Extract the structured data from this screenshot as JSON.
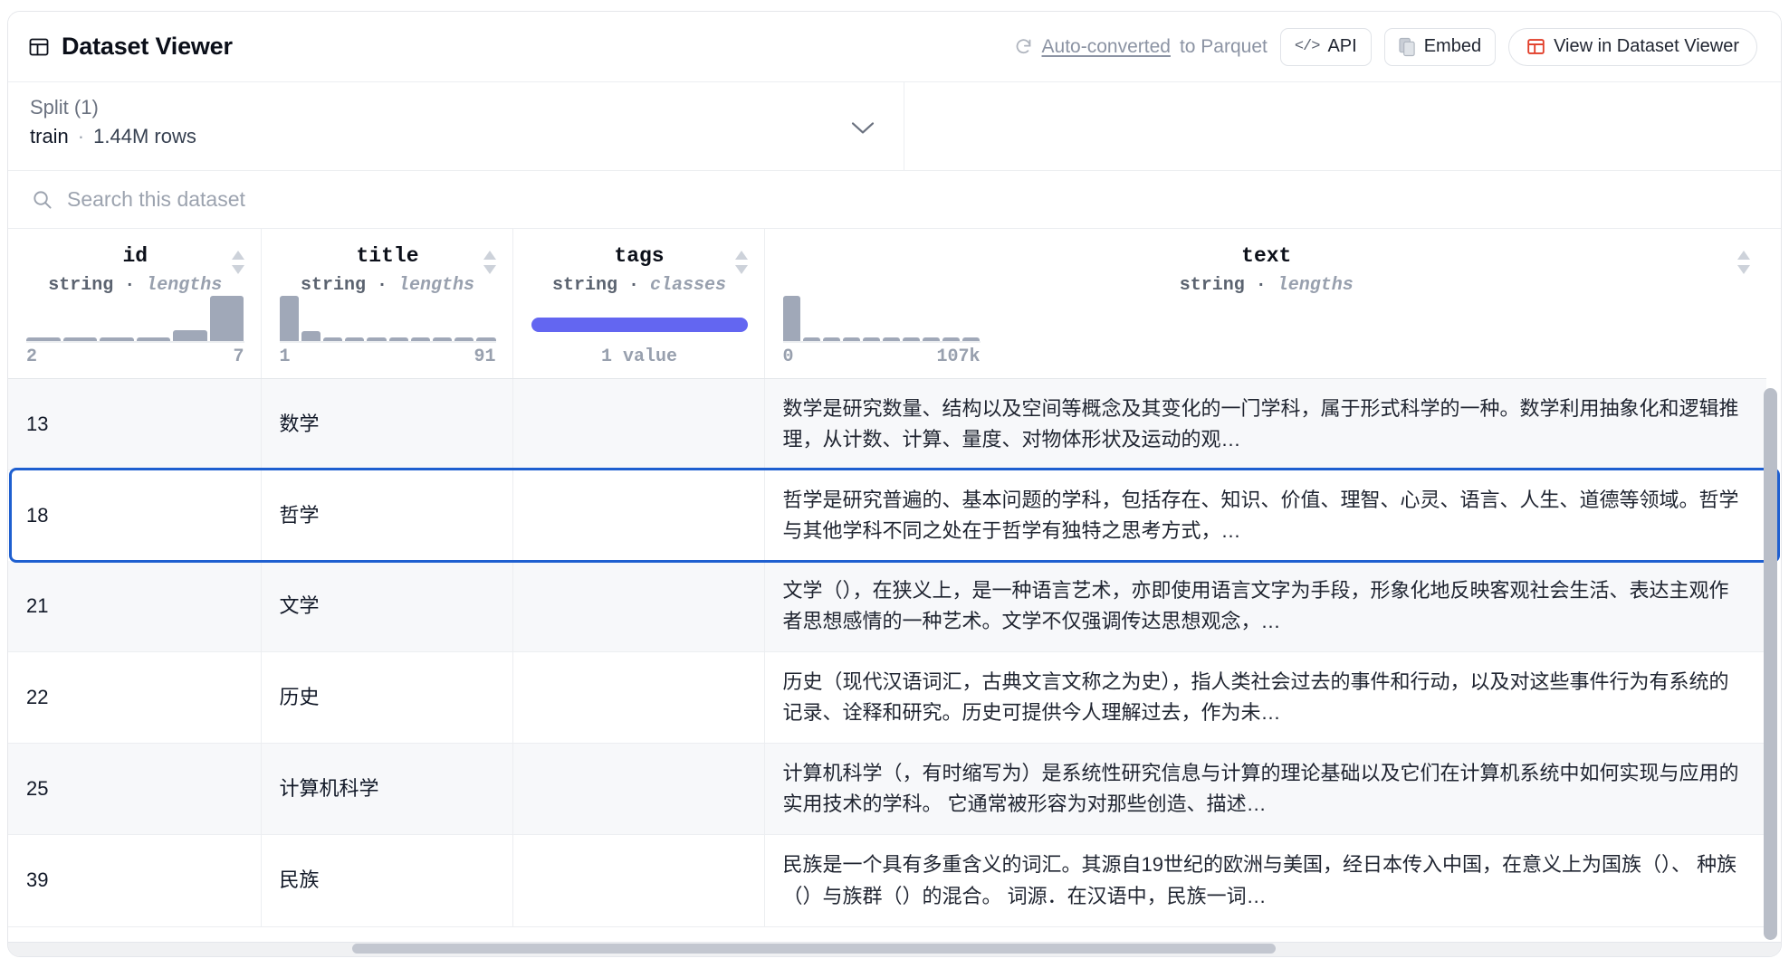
{
  "header": {
    "title": "Dataset Viewer",
    "title_icon": "grid-table-icon",
    "auto_converted": {
      "icon": "refresh-icon",
      "link_text": "Auto-converted",
      "suffix_text": " to Parquet"
    },
    "buttons": [
      {
        "id": "api",
        "label": "API",
        "icon": "code-brackets-icon"
      },
      {
        "id": "embed",
        "label": "Embed",
        "icon": "copy-icon"
      },
      {
        "id": "view-in-dataset-viewer",
        "label": "View in Dataset Viewer",
        "icon": "grid-table-icon-red"
      }
    ]
  },
  "split": {
    "label": "Split (1)",
    "name": "train",
    "separator": "·",
    "rows": "1.44M rows",
    "chevron_icon": "chevron-down-icon"
  },
  "search": {
    "placeholder": "Search this dataset",
    "value": "",
    "icon": "search-icon"
  },
  "columns": [
    {
      "name": "id",
      "type": "string",
      "stat": "lengths",
      "sortable": true,
      "hist": {
        "kind": "lengths",
        "min_label": "2",
        "max_label": "7",
        "bars": [
          4,
          4,
          4,
          4,
          12,
          50
        ]
      }
    },
    {
      "name": "title",
      "type": "string",
      "stat": "lengths",
      "sortable": true,
      "hist": {
        "kind": "lengths",
        "min_label": "1",
        "max_label": "91",
        "bars": [
          50,
          11,
          4,
          4,
          4,
          4,
          4,
          4,
          4,
          4
        ]
      }
    },
    {
      "name": "tags",
      "type": "string",
      "stat": "classes",
      "sortable": true,
      "hist": {
        "kind": "classes",
        "value_label": "1 value",
        "fill_ratio": 100,
        "color": "#6366f1"
      }
    },
    {
      "name": "text",
      "type": "string",
      "stat": "lengths",
      "sortable": true,
      "hist": {
        "kind": "lengths",
        "min_label": "0",
        "max_label": "107k",
        "bars": [
          50,
          4,
          4,
          4,
          4,
          4,
          4,
          4,
          4,
          4
        ]
      }
    }
  ],
  "rows": [
    {
      "id": "13",
      "title": "数学",
      "tags": "",
      "text": "数学是研究数量、结构以及空间等概念及其变化的一门学科，属于形式科学的一种。数学利用抽象化和逻辑推理，从计数、计算、量度、对物体形状及运动的观…",
      "selected": false
    },
    {
      "id": "18",
      "title": "哲学",
      "tags": "",
      "text": "哲学是研究普遍的、基本问题的学科，包括存在、知识、价值、理智、心灵、语言、人生、道德等领域。哲学与其他学科不同之处在于哲学有独特之思考方式，…",
      "selected": true
    },
    {
      "id": "21",
      "title": "文学",
      "tags": "",
      "text": "文学（），在狭义上，是一种语言艺术，亦即使用语言文字为手段，形象化地反映客观社会生活、表达主观作者思想感情的一种艺术。文学不仅强调传达思想观念，…",
      "selected": false
    },
    {
      "id": "22",
      "title": "历史",
      "tags": "",
      "text": "历史（现代汉语词汇，古典文言文称之为史），指人类社会过去的事件和行动，以及对这些事件行为有系统的记录、诠释和研究。历史可提供今人理解过去，作为未…",
      "selected": false
    },
    {
      "id": "25",
      "title": "计算机科学",
      "tags": "",
      "text": "计算机科学（，有时缩写为）是系统性研究信息与计算的理论基础以及它们在计算机系统中如何实现与应用的实用技术的学科。 它通常被形容为对那些创造、描述…",
      "selected": false
    },
    {
      "id": "39",
      "title": "民族",
      "tags": "",
      "text": "民族是一个具有多重含义的词汇。其源自19世纪的欧洲与美国，经日本传入中国，在意义上为国族（）、 种族（）与族群（）的混合。 词源．在汉语中，民族一词…",
      "selected": false
    }
  ]
}
